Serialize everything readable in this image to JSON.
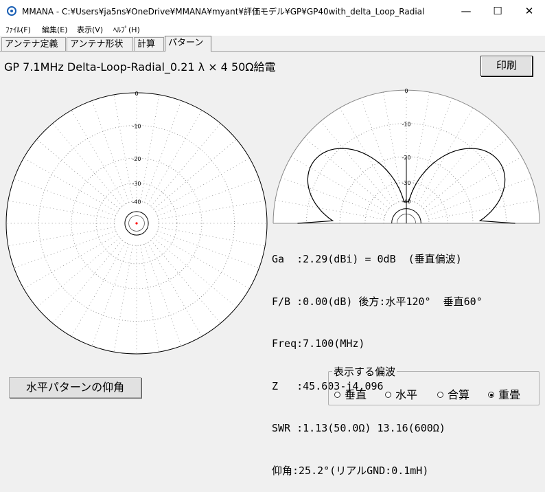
{
  "window": {
    "title": "MMANA - C:¥Users¥ja5ns¥OneDrive¥MMANA¥myant¥評価モデル¥GP¥GP40with_delta_Loop_Radial",
    "minimize": "—",
    "maximize": "☐",
    "close": "✕"
  },
  "menu": [
    {
      "label": "ﾌｧｲﾙ(F)"
    },
    {
      "label": "編集(E)"
    },
    {
      "label": "表示(V)"
    },
    {
      "label": "ﾍﾙﾌﾟ(H)"
    }
  ],
  "tabs": [
    {
      "label": "アンテナ定義"
    },
    {
      "label": "アンテナ形状"
    },
    {
      "label": "計算"
    },
    {
      "label": "パターン"
    }
  ],
  "active_tab": "パターン",
  "panel_title": "GP 7.1MHz Delta-Loop-Radial_0.21 λ × 4 50Ω給電",
  "print_button": "印刷",
  "horizontal_plot": {
    "ring_labels": [
      "0",
      "-10",
      "-20",
      "-30",
      "-40"
    ]
  },
  "vertical_plot": {
    "ring_labels": [
      "0",
      "-10",
      "-20",
      "-30",
      "-40"
    ]
  },
  "info": {
    "ga": "Ga  :2.29(dBi) = 0dB  (垂直偏波)",
    "fb": "F/B :0.00(dB) 後方:水平120°  垂直60°",
    "freq": "Freq:7.100(MHz)",
    "z": "Z   :45.603-j4.096",
    "swr": "SWR :1.13(50.0Ω) 13.16(600Ω)",
    "elev": "仰角:25.2°(リアルGND:0.1mH)"
  },
  "elevation_button": "水平パターンの仰角",
  "polarization": {
    "legend": "表示する偏波",
    "options": [
      {
        "label": "垂直",
        "selected": false
      },
      {
        "label": "水平",
        "selected": false
      },
      {
        "label": "合算",
        "selected": false
      },
      {
        "label": "重畳",
        "selected": true
      }
    ]
  },
  "colors": {
    "pattern": "#000000",
    "grid": "#808080",
    "marker": "#ff0000"
  },
  "chart_data": [
    {
      "type": "polar-horizontal",
      "rings_db": [
        0,
        -10,
        -20,
        -30,
        -40
      ],
      "pattern_db": -40,
      "note_values": "omnidirectional"
    },
    {
      "type": "polar-vertical",
      "rings_db": [
        0,
        -10,
        -20,
        -30,
        -40
      ],
      "peak_elevation_deg": 25.2
    }
  ]
}
